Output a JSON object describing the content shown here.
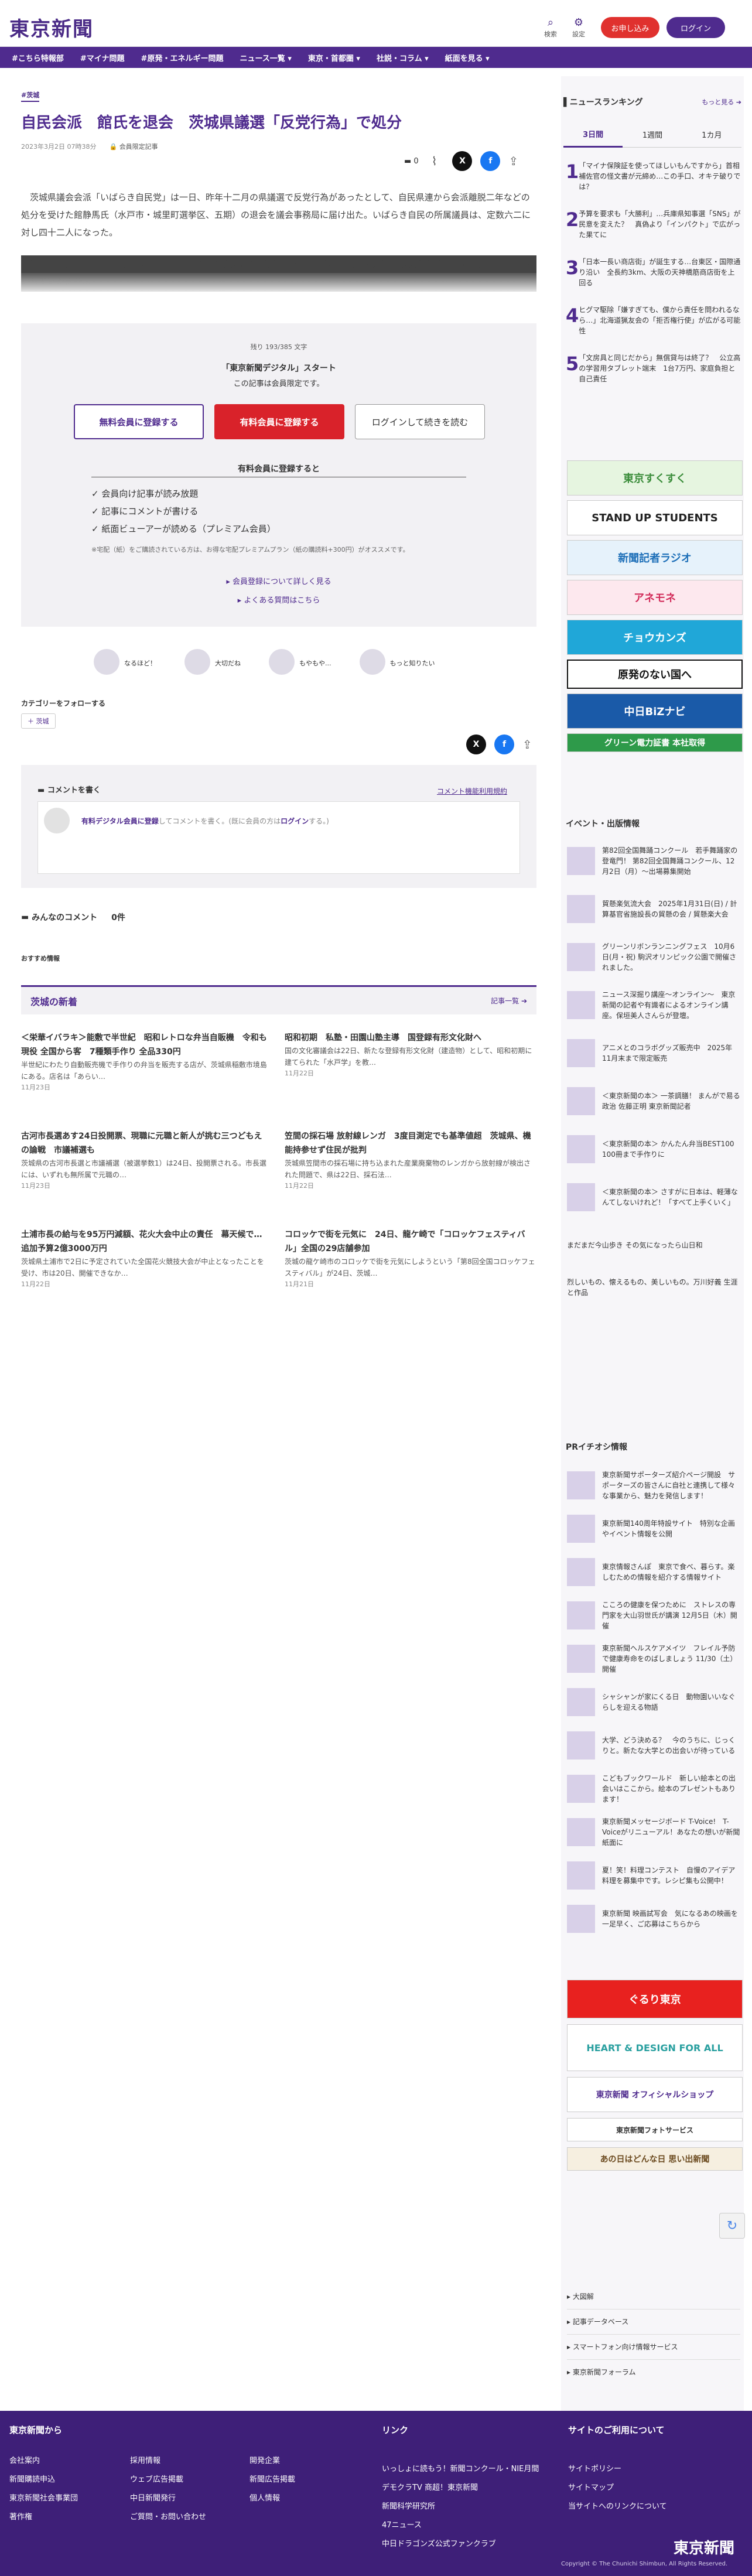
{
  "header": {
    "logo": "東京新聞",
    "search": "検索",
    "settings": "設定",
    "sub_btn": "お申し込み",
    "login_btn": "ログイン"
  },
  "nav": [
    "#こちら特報部",
    "#マイナ問題",
    "#原発・エネルギー問題",
    "ニュース一覧",
    "東京・首都圏",
    "社説・コラム",
    "紙面を見る"
  ],
  "article": {
    "tag": "#茨城",
    "title": "自民会派　館氏を退会　茨城県議選「反党行為」で処分",
    "date": "2023年3月2日 07時38分",
    "limited": "会員限定記事",
    "comment_count": "0",
    "p1": "茨城県議会会派「いばらき自民党」は一日、昨年十二月の県議選で反党行為があったとして、自民県連から会派離脱二年などの処分を受けた館静馬氏（水戸市・城里町選挙区、五期）の退会を議会事務局に届け出た。いばらき自民の所属議員は、定数六二に対し四十二人になった。",
    "p2": "館氏は二月二十七日に決定し、二十八日に館氏に通知。館氏が再審査を求めない意向を県連に伝えたため、当初四月一日付を予定していた処分…",
    "remaining": "残り 193/385 文字",
    "pay_title": "「東京新聞デジタル」スタート",
    "pay_sub": "この記事は会員限定です。",
    "btn_free": "無料会員に登録する",
    "btn_paid": "有料会員に登録する",
    "btn_login": "ログインして続きを読む",
    "benefits_title": "有料会員に登録すると",
    "benefits": [
      "会員向け記事が読み放題",
      "記事にコメントが書ける",
      "紙面ビューアーが読める（プレミアム会員）"
    ],
    "note": "※宅配（紙）をご購読されている方は、お得な宅配プレミアムプラン（紙の購読料+300円）がオススメです。",
    "link1": "会員登録について詳しく見る",
    "link2": "よくある質問はこちら",
    "reactions": [
      "なるほど！",
      "大切だね",
      "もやもや...",
      "もっと知りたい"
    ],
    "follow": "カテゴリーをフォローする",
    "follow_tag": "茨城"
  },
  "comments": {
    "write": "コメントを書く",
    "policy": "コメント機能利用規約",
    "box_link": "有料デジタル会員に登録",
    "box_text": "してコメントを書く。(既に会員の方は",
    "box_login": "ログイン",
    "box_end": "する。)",
    "all": "みんなのコメント",
    "all_count": "0件"
  },
  "recommend": "おすすめ情報",
  "ibaraki": {
    "title": "茨城の新着",
    "more": "記事一覧",
    "items": [
      {
        "h": "＜栄華イバラキ＞能敷で半世紀　昭和レトロな弁当自販機　令和も現役 全国から客　7種類手作り 全品330円",
        "s": "半世紀にわたり自動販売機で手作りの弁当を販売する店が、茨城県稲敷市境島にある。店名は「あらい…",
        "d": "11月23日"
      },
      {
        "h": "昭和初期　私塾・田園山塾主導　国登録有形文化財へ",
        "s": "国の文化審議会は22日、新たな登録有形文化財（建造物）として、昭和初期に建てられた「水戸学」を教…",
        "d": "11月22日"
      },
      {
        "h": "古河市長選あす24日投開票、現職に元職と新人が挑む三つどもえの論戦　市議補選も",
        "s": "茨城県の古河市長選と市議補選（被選挙数1）は24日、投開票される。市長選には、いずれも無所属で元職の…",
        "d": "11月23日"
      },
      {
        "h": "笠間の採石場 放射線レンガ　3度目測定でも基準値超　茨城県、機能持参せず住民が批判",
        "s": "茨城県笠間市の採石場に持ち込まれた産業廃棄物のレンガから放射線が検出された問題で、県は22日、採石法…",
        "d": "11月22日"
      },
      {
        "h": "土浦市長の給与を95万円減額、花火大会中止の責任　幕天候で…追加予算2億3000万円",
        "s": "茨城県土浦市で2日に予定されていた全国花火競技大会が中止となったことを受け、市は20日、開催できなか…",
        "d": "11月22日"
      },
      {
        "h": "コロッケで街を元気に　24日、龍ケ崎で「コロッケフェスティバル」全国の29店舗参加",
        "s": "茨城の龍ケ崎市のコロッケで街を元気にしようという「第8回全国コロッケフェスティバル」が24日、茨城…",
        "d": "11月21日"
      }
    ]
  },
  "sidebar": {
    "ranking_title": "ニュースランキング",
    "more": "もっと見る",
    "tabs": [
      "3日間",
      "1週間",
      "1カ月"
    ],
    "ranking": [
      "「マイナ保険証を使ってほしいもんですから」首相補佐官の怪文書が元締め…この手口、オキテ破りでは？",
      "予算を要求も「大勝利」…兵庫県知事選「SNS」が民意を変えた？　真偽より「インパクト」で広がった果てに",
      "「日本一長い商店街」が誕生する…台東区・国際通り沿い　全長約3km、大阪の天神橋筋商店街を上回る",
      "ヒグマ駆除「嫌すぎても、僕から責任を問われるなら…」北海道猟友会の「拒否権行使」が広がる可能性",
      "「文房具と同じだから」無償貸与は終了？　公立高の学習用タブレット端末　1台7万円、家庭負担と自己責任"
    ],
    "banners": [
      "東京すくすく",
      "STAND UP STUDENTS",
      "新聞記者ラジオ",
      "アネモネ",
      "チョウカンズ",
      "原発のない国へ",
      "中日BiZナビ",
      "グリーン電力証書 本社取得"
    ],
    "events_title": "イベント・出版情報",
    "events": [
      "第82回全国舞踊コンクール　若手舞踊家の登竜門！ 第82回全国舞踊コンクール、12月2日（月）～出場募集開始",
      "貿懸楽気流大会　2025年1月31日(日)  / 計算基官省施設長の貿懸の会 / 貿懸楽大会",
      "グリーンリボンランニングフェス　10月6日(月・祝) 駒沢オリンピック公園で開催されました。",
      "ニュース深掘り講座〜オンライン〜　東京新聞の記者や有識者によるオンライン講座。保垣美人さんらが登壇。",
      "アニメとのコラボグッズ販売中　2025年11月末まで限定販売",
      "＜東京新聞の本＞ 一茶調膳！ まんがで易る政治 佐藤正明 東京新聞記者",
      "＜東京新聞の本＞ かんたん弁当BEST100 100冊まで手作りに",
      "＜東京新聞の本＞ さすがに日本は、軽薄なんてしないけれど！「すべて上手くいく」",
      "まだまだ今山歩き その気になったら山日和",
      "烈しいもの、懐えるもの、美しいもの。万川好義 生涯と作品"
    ],
    "pr_title": "PRイチオシ情報",
    "pr": [
      "東京新聞サポーターズ紹介ページ開設　サポーターズの皆さんに自社と連携して様々な事業から、魅力を発信します！",
      "東京新聞140周年特設サイト　特別な企画やイベント情報を公開",
      "東京情報さんぽ　東京で食べ、暮らす。楽しむための情報を紹介する情報サイト",
      "こころの健康を保つために　ストレスの専門家を大山羽世氏が講演 12月5日（木）開催",
      "東京新聞ヘルスケアメイツ　フレイル予防で健康寿命をのばしましょう 11/30（土）開催",
      "シャシャンが家にくる日　動物園いいなぐらしを迎える物語",
      "大学、どう決める？　今のうちに、じっくりと。新たな大学との出会いが待っている",
      "こどもブックワールド　新しい絵本との出会いはここから。絵本のプレゼントもあります！",
      "東京新聞メッセージボード T-Voice!　T-Voiceがリニューアル！あなたの想いが新聞紙面に",
      "夏！笑！料理コンテスト　自慢のアイデア料理を募集中です。レシピ集も公開中！",
      "東京新聞 映画試写会　気になるあの映画を一足早く、ご応募はこちらから"
    ],
    "banners2": [
      "ぐるり東京",
      "HEART & DESIGN FOR ALL",
      "東京新聞 オフィシャルショップ",
      "東京新聞フォトサービス",
      "あの日はどんな日 思い出新聞"
    ],
    "links": [
      "大図解",
      "記事データベース",
      "スマートフォン向け情報サービス",
      "東京新聞フォーラム"
    ]
  },
  "footer": {
    "col1": "東京新聞から",
    "col1_items": [
      "会社案内",
      "採用情報",
      "開発企業",
      "新聞購読申込",
      "ウェブ広告掲載",
      "新聞広告掲載",
      "東京新聞社会事業団",
      "中日新聞発行",
      "個人情報",
      "著作権",
      "ご質問・お問い合わせ"
    ],
    "col2": "リンク",
    "col2_items": [
      "いっしょに読もう！新聞コンクール・NIE月間",
      "デモクラTV 商超！東京新聞",
      "新聞科学研究所",
      "47ニュース",
      "中日ドラゴンズ公式ファンクラブ"
    ],
    "col3": "サイトのご利用について",
    "col3_items": [
      "サイトポリシー",
      "サイトマップ",
      "当サイトへのリンクについて"
    ],
    "copy": "Copyright © The Chunichi Shimbun, All Rights Reserved.",
    "logo": "東京新聞"
  }
}
